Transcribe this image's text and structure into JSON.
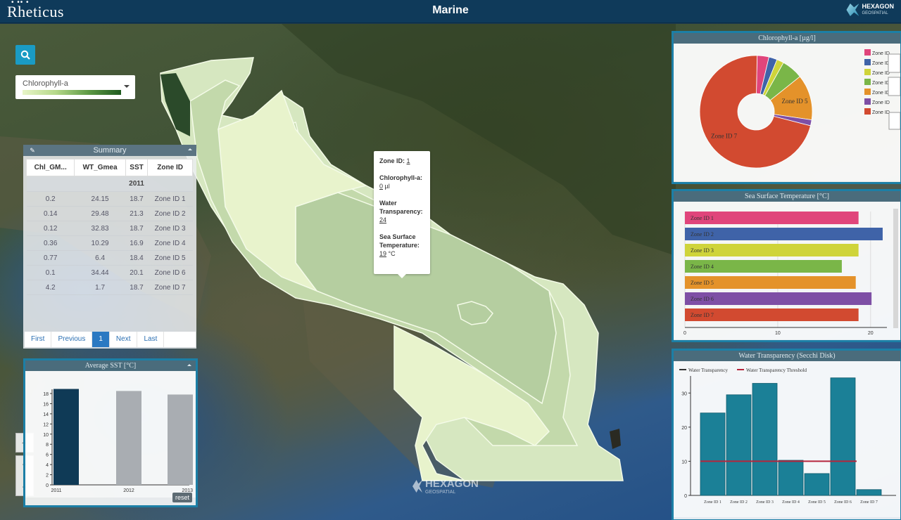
{
  "header": {
    "brand": "Rheticus",
    "title": "Marine",
    "logo_text": "HEXAGON",
    "logo_sub": "GEOSPATIAL"
  },
  "search": {
    "icon": "search-icon"
  },
  "layer_select": {
    "value": "Chlorophyll-a"
  },
  "summary": {
    "title": "Summary",
    "columns": [
      "Chl_GM...",
      "WT_Gmea",
      "SST",
      "Zone ID"
    ],
    "group": "2011",
    "rows": [
      [
        "0.2",
        "24.15",
        "18.7",
        "Zone ID 1"
      ],
      [
        "0.14",
        "29.48",
        "21.3",
        "Zone ID 2"
      ],
      [
        "0.12",
        "32.83",
        "18.7",
        "Zone ID 3"
      ],
      [
        "0.36",
        "10.29",
        "16.9",
        "Zone ID 4"
      ],
      [
        "0.77",
        "6.4",
        "18.4",
        "Zone ID 5"
      ],
      [
        "0.1",
        "34.44",
        "20.1",
        "Zone ID 6"
      ],
      [
        "4.2",
        "1.7",
        "18.7",
        "Zone ID 7"
      ]
    ],
    "pager": {
      "first": "First",
      "previous": "Previous",
      "page": "1",
      "next": "Next",
      "last": "Last"
    }
  },
  "avg_sst": {
    "title": "Average SST [°C]",
    "reset_label": "reset",
    "chart_data": {
      "type": "bar",
      "categories": [
        "2011",
        "2012",
        "2013"
      ],
      "values": [
        18.9,
        18.5,
        17.8
      ],
      "ylim": [
        0,
        18
      ],
      "yticks": [
        0,
        2,
        4,
        6,
        8,
        10,
        12,
        14,
        16,
        18
      ],
      "colors": [
        "#0f3a56",
        "#a9adb2",
        "#a9adb2"
      ]
    }
  },
  "chlorophyll": {
    "title": "Chlorophyll-a [µg/l]",
    "chart_data": {
      "type": "pie",
      "labels": [
        "Zone ID 1",
        "Zone ID 2",
        "Zone ID 3",
        "Zone ID 4",
        "Zone ID 5",
        "Zone ID 6",
        "Zone ID 7"
      ],
      "values": [
        0.2,
        0.14,
        0.12,
        0.36,
        0.77,
        0.1,
        4.2
      ],
      "colors": [
        "#e0457b",
        "#3f63a8",
        "#cfd43a",
        "#7ab648",
        "#e4922a",
        "#7e4fa5",
        "#d24a30"
      ],
      "slice_labels": [
        "Zone ID 5",
        "Zone ID 7"
      ],
      "legend": [
        "Zone ID",
        "Zone ID",
        "Zone ID",
        "Zone ID",
        "Zone ID",
        "Zone ID",
        "Zone ID"
      ]
    }
  },
  "sst_panel": {
    "title": "Sea Surface Temperature [°C]",
    "chart_data": {
      "type": "bar",
      "orientation": "horizontal",
      "categories": [
        "Zone ID 1",
        "Zone ID 2",
        "Zone ID 3",
        "Zone ID 4",
        "Zone ID 5",
        "Zone ID 6",
        "Zone ID 7"
      ],
      "values": [
        18.7,
        21.3,
        18.7,
        16.9,
        18.4,
        20.1,
        18.7
      ],
      "colors": [
        "#e0457b",
        "#3f63a8",
        "#cfd43a",
        "#7ab648",
        "#e4922a",
        "#7e4fa5",
        "#d24a30"
      ],
      "xlim": [
        0,
        21
      ],
      "xticks": [
        0,
        10,
        20
      ]
    }
  },
  "wt_panel": {
    "title": "Water Transparency (Secchi Disk)",
    "chart_data": {
      "type": "bar",
      "categories": [
        "Zone ID 1",
        "Zone ID 2",
        "Zone ID 3",
        "Zone ID 4",
        "Zone ID 5",
        "Zone ID 6",
        "Zone ID 7"
      ],
      "series": [
        {
          "name": "Water Transparency",
          "values": [
            24.15,
            29.48,
            32.83,
            10.29,
            6.4,
            34.44,
            1.7
          ],
          "color": "#1b8097"
        },
        {
          "name": "Water Transparency Threshold",
          "values": [
            10,
            10,
            10,
            10,
            10,
            10,
            10
          ],
          "color": "#b5253c"
        }
      ],
      "ylim": [
        0,
        35
      ],
      "yticks": [
        0,
        10,
        20,
        30
      ]
    }
  },
  "tooltip": {
    "zone_label": "Zone ID:",
    "zone_value": "1",
    "chl_label": "Chlorophyll-a:",
    "chl_value": "0",
    "chl_unit": "µl",
    "wt_label": "Water Transparency:",
    "wt_value": "24",
    "sst_label": "Sea Surface Temperature:",
    "sst_value": "19",
    "sst_unit": "°C"
  },
  "watermark": {
    "text": "HEXAGON",
    "sub": "GEOSPATIAL"
  }
}
